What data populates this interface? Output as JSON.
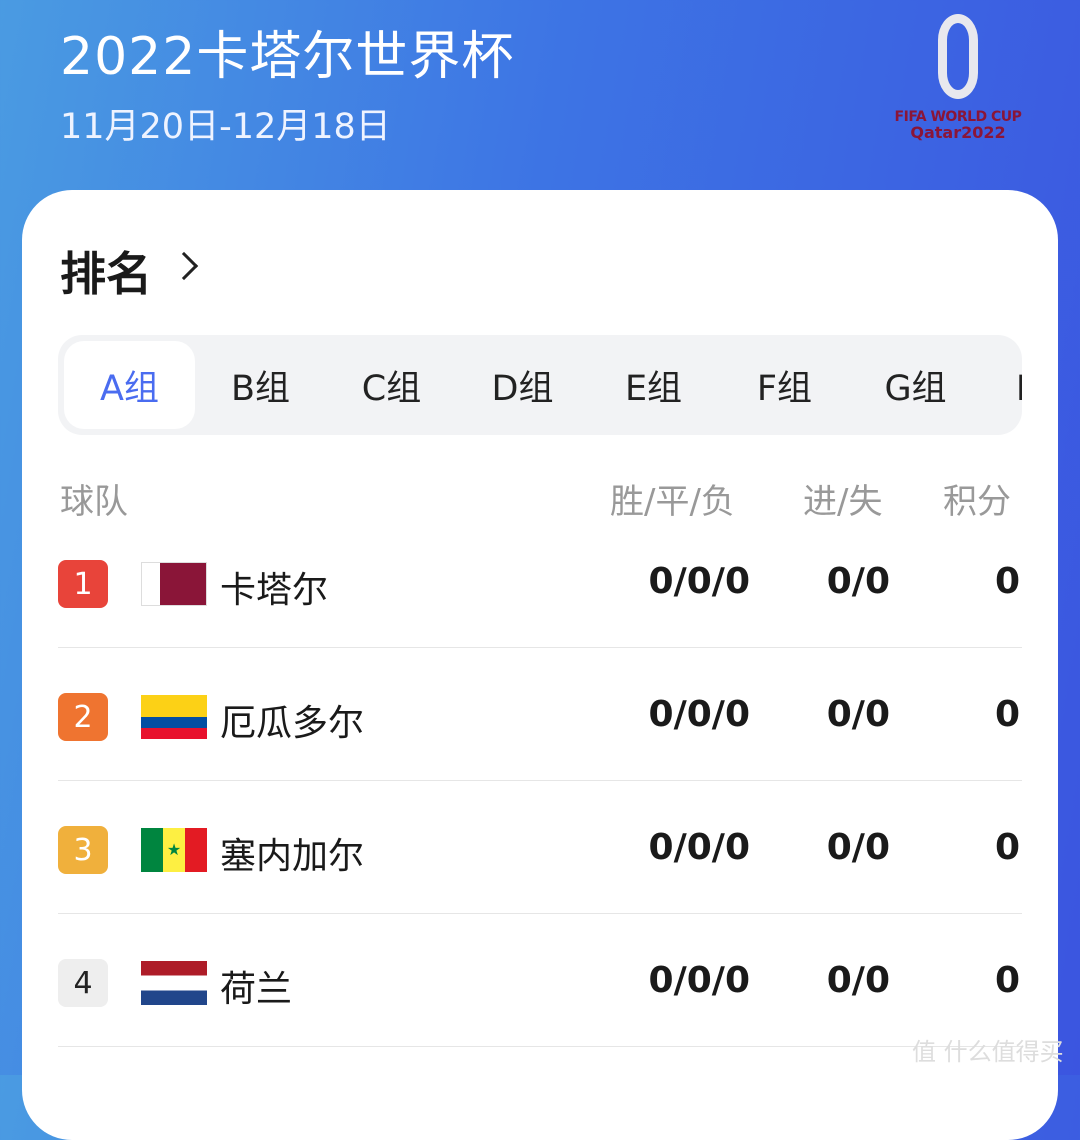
{
  "header": {
    "title": "2022卡塔尔世界杯",
    "dates": "11月20日-12月18日",
    "logo_line1": "FIFA WORLD CUP",
    "logo_line2": "Qatar2022"
  },
  "section": {
    "title": "排名"
  },
  "tabs": [
    {
      "label": "A组",
      "active": true
    },
    {
      "label": "B组"
    },
    {
      "label": "C组"
    },
    {
      "label": "D组"
    },
    {
      "label": "E组"
    },
    {
      "label": "F组"
    },
    {
      "label": "G组"
    },
    {
      "label": "H组"
    }
  ],
  "table": {
    "headers": {
      "team": "球队",
      "wdl": "胜/平/负",
      "goals": "进/失",
      "points": "积分"
    },
    "rows": [
      {
        "rank": "1",
        "team": "卡塔尔",
        "wdl": "0/0/0",
        "goals": "0/0",
        "points": "0",
        "badge_color": "#e8443a"
      },
      {
        "rank": "2",
        "team": "厄瓜多尔",
        "wdl": "0/0/0",
        "goals": "0/0",
        "points": "0",
        "badge_color": "#ef7430"
      },
      {
        "rank": "3",
        "team": "塞内加尔",
        "wdl": "0/0/0",
        "goals": "0/0",
        "points": "0",
        "badge_color": "#f0b03c"
      },
      {
        "rank": "4",
        "team": "荷兰",
        "wdl": "0/0/0",
        "goals": "0/0",
        "points": "0",
        "badge_color": "#eeeeee"
      }
    ]
  },
  "watermark": "值 什么值得买"
}
